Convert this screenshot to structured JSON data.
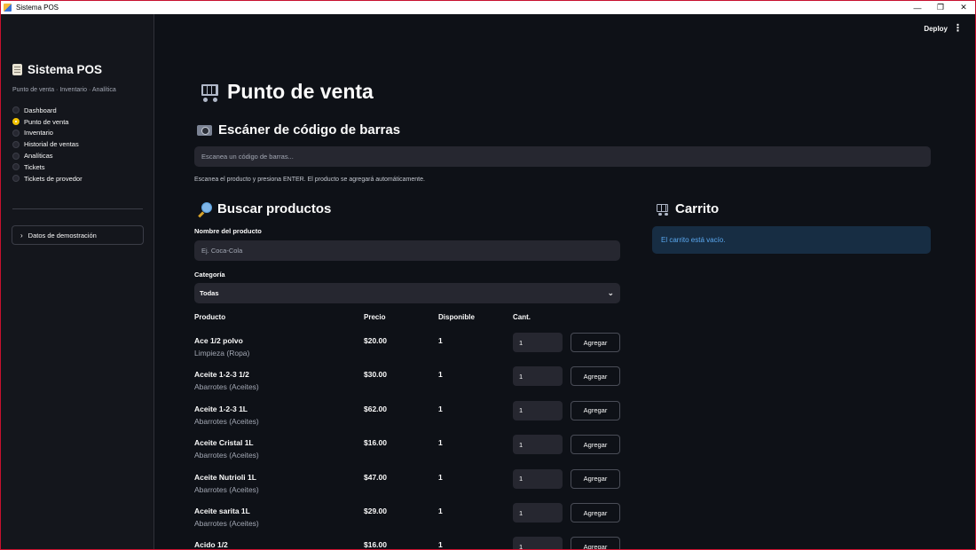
{
  "window": {
    "title": "Sistema POS"
  },
  "header": {
    "deploy_label": "Deploy",
    "menu_icon": "kebab-menu-icon"
  },
  "sidebar": {
    "title": "Sistema POS",
    "subtitle": "Punto de venta · Inventario · Analítica",
    "nav": [
      {
        "label": "Dashboard",
        "selected": false
      },
      {
        "label": "Punto de venta",
        "selected": true
      },
      {
        "label": "Inventario",
        "selected": false
      },
      {
        "label": "Historial de ventas",
        "selected": false
      },
      {
        "label": "Analíticas",
        "selected": false
      },
      {
        "label": "Tickets",
        "selected": false
      },
      {
        "label": "Tickets de provedor",
        "selected": false
      }
    ],
    "expander_label": "Datos de demostración"
  },
  "main": {
    "title": "Punto de venta",
    "scanner": {
      "heading": "Escáner de código de barras",
      "placeholder": "Escanea un código de barras...",
      "caption": "Escanea el producto y presiona ENTER. El producto se agregará automáticamente."
    },
    "search": {
      "heading": "Buscar productos",
      "name_label": "Nombre del producto",
      "name_placeholder": "Ej. Coca-Cola",
      "category_label": "Categoría",
      "category_value": "Todas"
    },
    "table": {
      "headers": [
        "Producto",
        "Precio",
        "Disponible",
        "Cant."
      ],
      "add_label": "Agregar",
      "rows": [
        {
          "name": "Ace 1/2 polvo",
          "category": "Limpieza (Ropa)",
          "price": "$20.00",
          "available": "1",
          "qty": "1"
        },
        {
          "name": "Aceite 1-2-3 1/2",
          "category": "Abarrotes (Aceites)",
          "price": "$30.00",
          "available": "1",
          "qty": "1"
        },
        {
          "name": "Aceite 1-2-3 1L",
          "category": "Abarrotes (Aceites)",
          "price": "$62.00",
          "available": "1",
          "qty": "1"
        },
        {
          "name": "Aceite Cristal 1L",
          "category": "Abarrotes (Aceites)",
          "price": "$16.00",
          "available": "1",
          "qty": "1"
        },
        {
          "name": "Aceite Nutrioli 1L",
          "category": "Abarrotes (Aceites)",
          "price": "$47.00",
          "available": "1",
          "qty": "1"
        },
        {
          "name": "Aceite sarita 1L",
          "category": "Abarrotes (Aceites)",
          "price": "$29.00",
          "available": "1",
          "qty": "1"
        },
        {
          "name": "Acido 1/2",
          "category": "",
          "price": "$16.00",
          "available": "1",
          "qty": "1"
        }
      ]
    },
    "cart": {
      "heading": "Carrito",
      "empty_message": "El carrito está vacío."
    }
  },
  "colors": {
    "accent": "#f2c200",
    "info_bg": "#172d43",
    "info_text": "#5aa8f0"
  }
}
